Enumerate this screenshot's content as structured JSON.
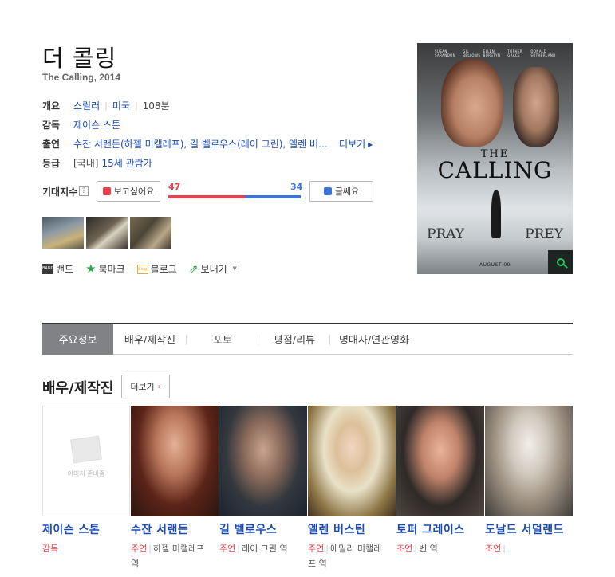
{
  "movie": {
    "title": "더 콜링",
    "subtitle": "The Calling, 2014"
  },
  "info": {
    "genre_label": "개요",
    "genre": "스릴러",
    "country": "미국",
    "runtime": "108분",
    "director_label": "감독",
    "director": "제이슨 스톤",
    "cast_label": "출연",
    "cast_text": "수잔 서랜든(하젤 미캘레프), 길 벨로우스(레이 그린), 엘렌 버스틴(에밀리 미캘레프 역)",
    "more_label": "더보기",
    "rating_label": "등급",
    "rating_prefix": "[국내]",
    "rating": "15세 관람가"
  },
  "expect": {
    "label": "기대지수",
    "help": "?",
    "want_label": "보고싶어요",
    "meh_label": "글쎄요",
    "want_count": "47",
    "meh_count": "34",
    "want_fraction": 0.58
  },
  "share": {
    "band": "밴드",
    "bookmark": "북마크",
    "blog": "블로그",
    "send": "보내기",
    "band_icon_text": "BAND",
    "blog_icon_text": "blog"
  },
  "poster": {
    "credits": [
      "SUSAN SARANDON",
      "GIL BELLOWS",
      "ELLEN BURSTYN",
      "TOPHER GRACE",
      "DONALD SUTHERLAND"
    ],
    "title_the": "THE",
    "title_main": "CALLING",
    "tag_left": "PRAY",
    "tag_right": "PREY",
    "date": "AUGUST 09"
  },
  "tabs": [
    {
      "label": "주요정보",
      "active": true
    },
    {
      "label": "배우/제작진",
      "active": false
    },
    {
      "label": "포토",
      "active": false
    },
    {
      "label": "평점/리뷰",
      "active": false
    },
    {
      "label": "명대사/연관영화",
      "active": false
    }
  ],
  "cast_section": {
    "title": "배우/제작진",
    "more_label": "더보기",
    "noimage_text": "이미지 준비중",
    "people": [
      {
        "name": "제이슨 스톤",
        "role": "감독",
        "character": ""
      },
      {
        "name": "수잔 서랜든",
        "role": "주연",
        "character": "하젤 미캘레프 역"
      },
      {
        "name": "길 벨로우스",
        "role": "주연",
        "character": "레이 그린 역"
      },
      {
        "name": "엘렌 버스틴",
        "role": "주연",
        "character": "에밀리 미캘레프 역"
      },
      {
        "name": "토퍼 그레이스",
        "role": "조연",
        "character": "벤 역"
      },
      {
        "name": "도날드 서덜랜드",
        "role": "조연",
        "character": ""
      }
    ]
  },
  "colors": {
    "link": "#1a4bb3",
    "want": "#e8414a",
    "meh": "#3b75d9",
    "tab_active": "#808285"
  }
}
